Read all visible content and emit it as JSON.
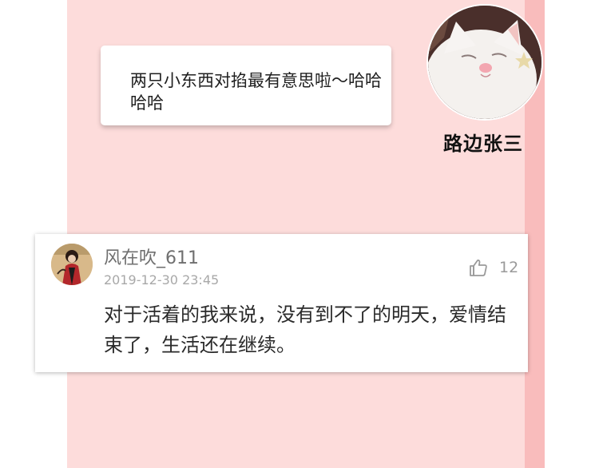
{
  "chat": {
    "message": "两只小东西对掐最有意思啦～哈哈哈哈",
    "speaker": "路边张三"
  },
  "comment": {
    "username": "风在吹_611",
    "timestamp": "2019-12-30 23:45",
    "like_count": "12",
    "text": "对于活着的我来说，没有到不了的明天，爱情结束了，生活还在继续。"
  },
  "colors": {
    "strip": "#fddcdb",
    "edge": "#f9bcbc"
  }
}
